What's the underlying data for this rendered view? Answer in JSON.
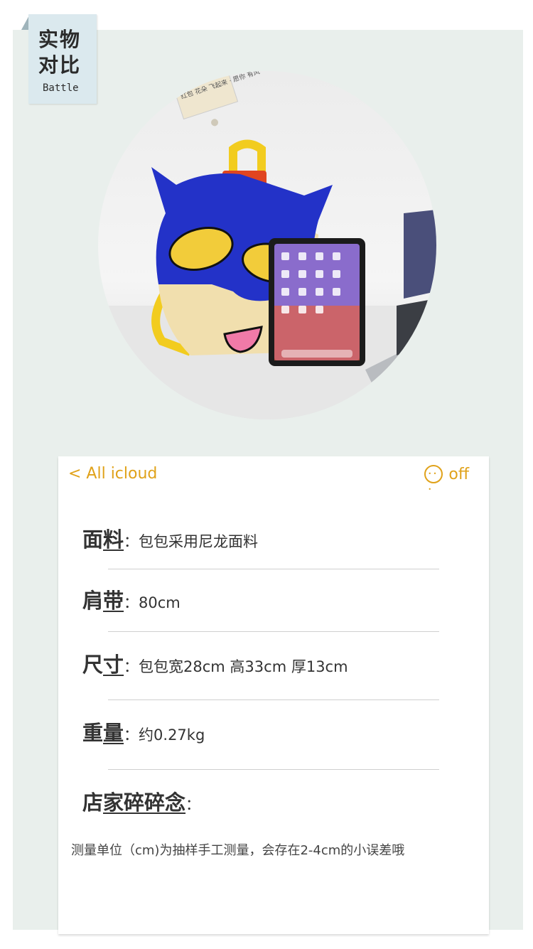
{
  "badge": {
    "line1": "实物",
    "line2": "对比",
    "sub": "Battle"
  },
  "nav": {
    "back": "< All icloud",
    "menu_icon": "more-dots-icon",
    "right": "off"
  },
  "specs": [
    {
      "label_a": "面",
      "label_b": "料",
      "value": "：包包采用尼龙面料"
    },
    {
      "label_a": "肩",
      "label_b": "带",
      "value": "：80cm"
    },
    {
      "label_a": "尺",
      "label_b": "寸",
      "value": "：包包宽28cm 高33cm 厚13cm"
    },
    {
      "label_a": "重",
      "label_b": "量",
      "value": "：约0.27kg"
    },
    {
      "label_a": "店",
      "label_b": "家碎碎念",
      "value": "："
    }
  ],
  "note": "测量单位（cm)为抽样手工测量，会存在2-4cm的小误差哦",
  "photo": {
    "hang_tag": "红包 花朵 飞起来 · 愿你 有风",
    "colors": {
      "mask": "#2332c8",
      "eyes": "#f2cc3a",
      "face": "#f1dfae",
      "strap": "#f2cc1f",
      "handle_patch": "#e04520",
      "mouth": "#f07aa8"
    }
  }
}
